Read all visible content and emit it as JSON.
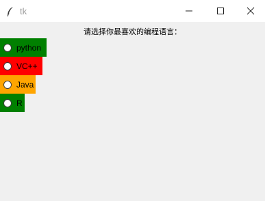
{
  "window": {
    "title": "tk"
  },
  "prompt": {
    "text": "请选择你最喜欢的编程语言："
  },
  "options": [
    {
      "label": "python",
      "color": "#008000"
    },
    {
      "label": "VC++",
      "color": "#ff0000"
    },
    {
      "label": "Java",
      "color": "#ffa500"
    },
    {
      "label": "R",
      "color": "#008000"
    }
  ]
}
